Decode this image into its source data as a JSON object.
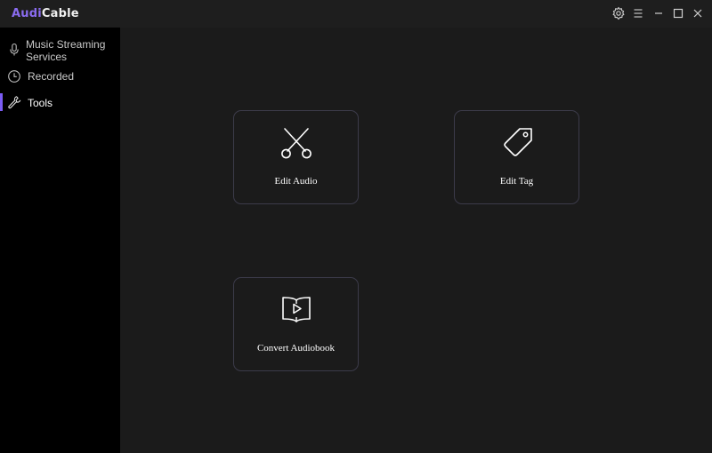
{
  "app": {
    "name_part1": "Aud",
    "name_part2": "i",
    "name_part3": "Cable"
  },
  "window_controls": [
    {
      "icon": "gear-icon"
    },
    {
      "icon": "menu-icon"
    },
    {
      "icon": "minimize-icon"
    },
    {
      "icon": "maximize-icon"
    },
    {
      "icon": "close-icon"
    }
  ],
  "sidebar": {
    "items": [
      {
        "label_line1": "Music Streaming",
        "label_line2": "Services",
        "icon": "microphone-icon",
        "active": false
      },
      {
        "label": "Recorded",
        "icon": "clock-icon",
        "active": false
      },
      {
        "label": "Tools",
        "icon": "wrench-icon",
        "active": true
      }
    ]
  },
  "tools": [
    {
      "label": "Edit Audio",
      "icon": "scissors-icon"
    },
    {
      "label": "Edit Tag",
      "icon": "tag-icon"
    },
    {
      "label": "Convert Audiobook",
      "icon": "book-play-icon"
    }
  ],
  "colors": {
    "accent": "#7b5cf5",
    "brand": "#8a6cf0",
    "background": "#1b1b1b",
    "sidebar": "#000000"
  }
}
